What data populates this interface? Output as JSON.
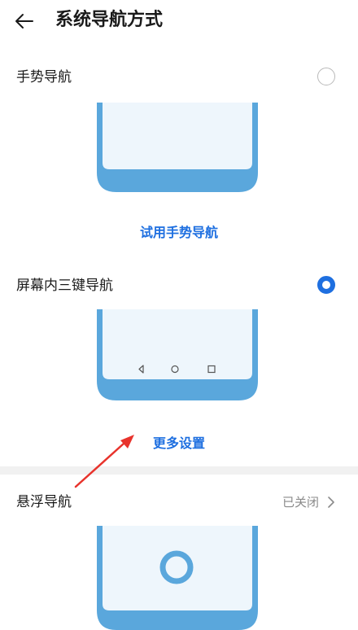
{
  "header": {
    "back_icon": "arrow-left-icon",
    "title": "系统导航方式"
  },
  "gesture_nav": {
    "label": "手势导航",
    "selected": false,
    "try_link": "试用手势导航"
  },
  "three_key_nav": {
    "label": "屏幕内三键导航",
    "selected": true,
    "more_settings": "更多设置",
    "nav_icons": [
      "back-triangle-icon",
      "home-circle-icon",
      "recents-square-icon"
    ]
  },
  "floating_nav": {
    "label": "悬浮导航",
    "status": "已关闭",
    "chevron_icon": "chevron-right-icon"
  },
  "colors": {
    "accent": "#1e6fe0",
    "phone_frame": "#5aa7dc",
    "phone_screen": "#eef6fc",
    "annotation_arrow": "#e8332c"
  }
}
